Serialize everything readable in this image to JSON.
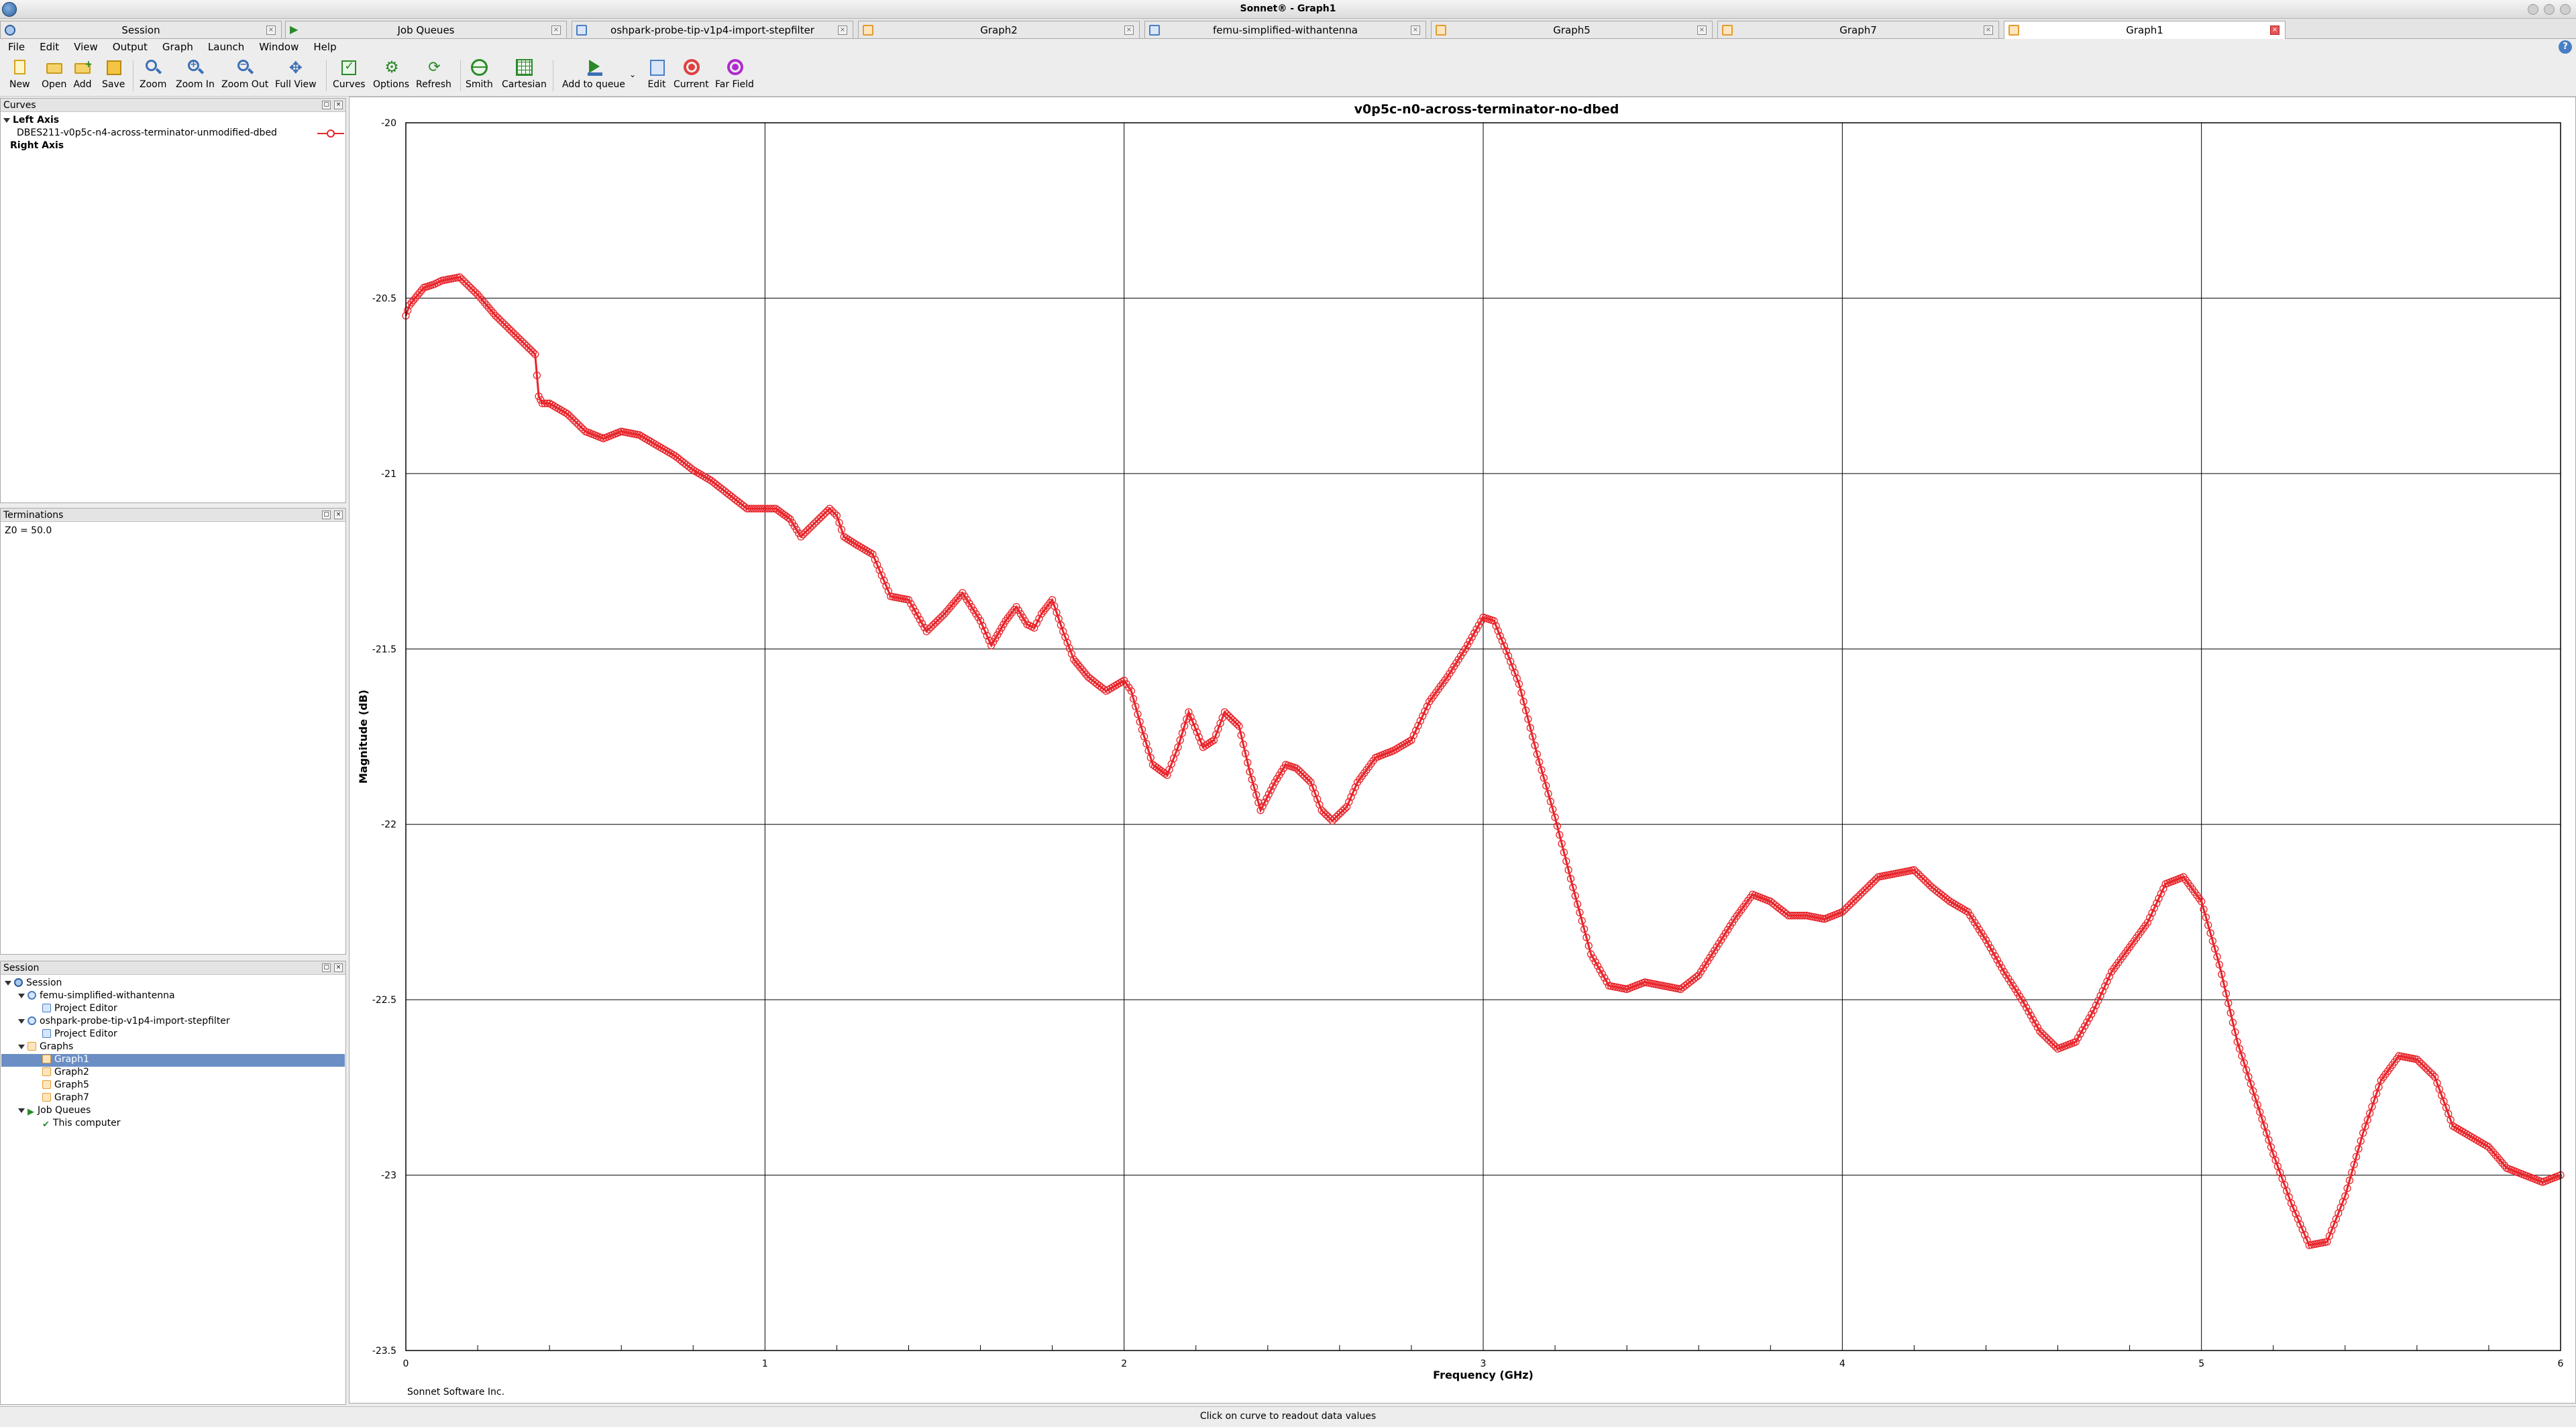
{
  "window": {
    "title": "Sonnet® - Graph1"
  },
  "tabs": [
    {
      "label": "Session",
      "icon": "session-icon"
    },
    {
      "label": "Job Queues",
      "icon": "job-queue-icon"
    },
    {
      "label": "oshpark-probe-tip-v1p4-import-stepfilter",
      "icon": "project-icon"
    },
    {
      "label": "Graph2",
      "icon": "graph-icon"
    },
    {
      "label": "femu-simplified-withantenna",
      "icon": "project-icon"
    },
    {
      "label": "Graph5",
      "icon": "graph-icon"
    },
    {
      "label": "Graph7",
      "icon": "graph-icon"
    },
    {
      "label": "Graph1",
      "icon": "graph-icon",
      "active": true
    }
  ],
  "menu": [
    "File",
    "Edit",
    "View",
    "Output",
    "Graph",
    "Launch",
    "Window",
    "Help"
  ],
  "toolbar": {
    "new": "New",
    "open": "Open",
    "add": "Add",
    "save": "Save",
    "zoom": "Zoom",
    "zoom_in": "Zoom In",
    "zoom_out": "Zoom Out",
    "full_view": "Full View",
    "curves": "Curves",
    "options": "Options",
    "refresh": "Refresh",
    "smith": "Smith",
    "cartesian": "Cartesian",
    "add_to_queue": "Add to queue",
    "edit": "Edit",
    "current": "Current",
    "far_field": "Far Field"
  },
  "curves_panel": {
    "title": "Curves",
    "left_axis": "Left Axis",
    "curve": "DBES211-v0p5c-n4-across-terminator-unmodified-dbed",
    "right_axis": "Right Axis"
  },
  "terminations_panel": {
    "title": "Terminations",
    "z0": "Z0 = 50.0"
  },
  "session_panel": {
    "title": "Session",
    "root": "Session",
    "project1": "femu-simplified-withantenna",
    "project1_editor": "Project Editor",
    "project2": "oshpark-probe-tip-v1p4-import-stepfilter",
    "project2_editor": "Project Editor",
    "graphs": "Graphs",
    "graph_items": [
      "Graph1",
      "Graph2",
      "Graph5",
      "Graph7"
    ],
    "job_queues": "Job Queues",
    "this_computer": "This computer"
  },
  "colors": {
    "curve": "#e8252b",
    "selection": "#6b8fc4",
    "grid": "#000000"
  },
  "chart_data": {
    "type": "scatter",
    "title": "v0p5c-n0-across-terminator-no-dbed",
    "xlabel": "Frequency (GHz)",
    "ylabel": "Magnitude (dB)",
    "xlim": [
      0,
      6
    ],
    "ylim": [
      -23.5,
      -20
    ],
    "xticks": [
      "0",
      "1",
      "2",
      "3",
      "4",
      "5",
      "6"
    ],
    "yticks": [
      "-20",
      "-20.5",
      "-21",
      "-21.5",
      "-22",
      "-22.5",
      "-23",
      "-23.5"
    ],
    "grid": true,
    "credit": "Sonnet Software Inc.",
    "series": [
      {
        "marker": "circle",
        "x": [
          0,
          0.01,
          0.05,
          0.08,
          0.1,
          0.15,
          0.2,
          0.25,
          0.3,
          0.33,
          0.36,
          0.37,
          0.38,
          0.4,
          0.45,
          0.5,
          0.55,
          0.6,
          0.65,
          0.7,
          0.75,
          0.8,
          0.85,
          0.9,
          0.95,
          1.0,
          1.03,
          1.07,
          1.1,
          1.15,
          1.18,
          1.2,
          1.22,
          1.25,
          1.3,
          1.35,
          1.4,
          1.45,
          1.5,
          1.55,
          1.6,
          1.63,
          1.67,
          1.7,
          1.73,
          1.75,
          1.77,
          1.8,
          1.83,
          1.86,
          1.9,
          1.95,
          2.0,
          2.02,
          2.05,
          2.08,
          2.12,
          2.15,
          2.18,
          2.22,
          2.25,
          2.28,
          2.32,
          2.35,
          2.38,
          2.42,
          2.45,
          2.48,
          2.52,
          2.55,
          2.58,
          2.62,
          2.65,
          2.7,
          2.75,
          2.8,
          2.85,
          2.9,
          2.95,
          3.0,
          3.03,
          3.07,
          3.1,
          3.15,
          3.2,
          3.25,
          3.3,
          3.35,
          3.4,
          3.45,
          3.5,
          3.55,
          3.6,
          3.65,
          3.7,
          3.75,
          3.8,
          3.85,
          3.9,
          3.95,
          4.0,
          4.05,
          4.1,
          4.15,
          4.2,
          4.25,
          4.3,
          4.35,
          4.4,
          4.45,
          4.5,
          4.55,
          4.6,
          4.65,
          4.7,
          4.75,
          4.8,
          4.85,
          4.9,
          4.95,
          5.0,
          5.05,
          5.1,
          5.15,
          5.2,
          5.25,
          5.3,
          5.35,
          5.4,
          5.45,
          5.5,
          5.55,
          5.6,
          5.65,
          5.7,
          5.75,
          5.8,
          5.85,
          5.9,
          5.95,
          6.0
        ],
        "y": [
          -20.55,
          -20.52,
          -20.47,
          -20.46,
          -20.45,
          -20.44,
          -20.49,
          -20.55,
          -20.6,
          -20.63,
          -20.66,
          -20.78,
          -20.8,
          -20.8,
          -20.83,
          -20.88,
          -20.9,
          -20.88,
          -20.89,
          -20.92,
          -20.95,
          -20.99,
          -21.02,
          -21.06,
          -21.1,
          -21.1,
          -21.1,
          -21.13,
          -21.18,
          -21.13,
          -21.1,
          -21.12,
          -21.18,
          -21.2,
          -21.23,
          -21.35,
          -21.36,
          -21.45,
          -21.4,
          -21.34,
          -21.42,
          -21.49,
          -21.42,
          -21.38,
          -21.43,
          -21.44,
          -21.4,
          -21.36,
          -21.45,
          -21.53,
          -21.58,
          -21.62,
          -21.59,
          -21.62,
          -21.73,
          -21.83,
          -21.86,
          -21.78,
          -21.68,
          -21.78,
          -21.76,
          -21.68,
          -21.72,
          -21.85,
          -21.96,
          -21.88,
          -21.83,
          -21.84,
          -21.88,
          -21.96,
          -21.99,
          -21.95,
          -21.88,
          -21.81,
          -21.79,
          -21.76,
          -21.65,
          -21.58,
          -21.5,
          -21.41,
          -21.42,
          -21.52,
          -21.6,
          -21.8,
          -21.98,
          -22.18,
          -22.37,
          -22.46,
          -22.47,
          -22.45,
          -22.46,
          -22.47,
          -22.43,
          -22.35,
          -22.27,
          -22.2,
          -22.22,
          -22.26,
          -22.26,
          -22.27,
          -22.25,
          -22.2,
          -22.15,
          -22.14,
          -22.13,
          -22.18,
          -22.22,
          -22.25,
          -22.33,
          -22.42,
          -22.5,
          -22.59,
          -22.64,
          -22.62,
          -22.53,
          -22.42,
          -22.35,
          -22.28,
          -22.17,
          -22.15,
          -22.22,
          -22.4,
          -22.62,
          -22.78,
          -22.94,
          -23.08,
          -23.2,
          -23.19,
          -23.06,
          -22.88,
          -22.73,
          -22.66,
          -22.67,
          -22.72,
          -22.86,
          -22.89,
          -22.92,
          -22.98,
          -23.0,
          -23.02,
          -23.0
        ]
      }
    ]
  }
}
